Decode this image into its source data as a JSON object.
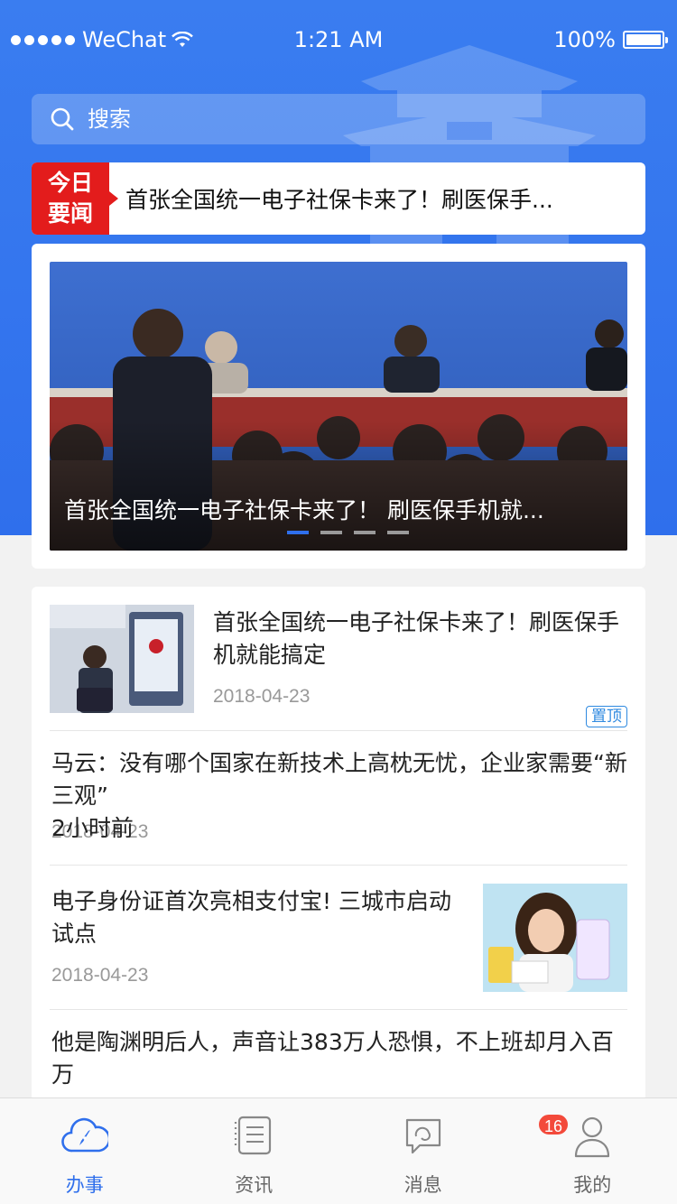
{
  "status_bar": {
    "carrier": "WeChat",
    "time": "1:21 AM",
    "battery": "100%"
  },
  "search": {
    "placeholder": "搜索"
  },
  "today_news": {
    "badge_line1": "今日",
    "badge_line2": "要闻",
    "headline": "首张全国统一电子社保卡来了！刷医保手..."
  },
  "carousel": {
    "caption": "首张全国统一电子社保卡来了！ 刷医保手机就...",
    "active_index": 0,
    "slide_count": 4
  },
  "news": [
    {
      "title": "首张全国统一电子社保卡来了！刷医保手机就能搞定",
      "date": "2018-04-23",
      "tag": "置顶"
    },
    {
      "title": "马云：没有哪个国家在新技术上高枕无忧，企业家需要“新三观”",
      "date": "2018-04-23",
      "time_ago": "2小时前"
    },
    {
      "title": "电子身份证首次亮相支付宝! 三城市启动试点",
      "date": "2018-04-23"
    },
    {
      "title": "他是陶渊明后人，声音让383万人恐惧，不上班却月入百万"
    }
  ],
  "tabs": [
    {
      "label": "办事",
      "icon": "compass-icon",
      "active": true
    },
    {
      "label": "资讯",
      "icon": "news-icon"
    },
    {
      "label": "消息",
      "icon": "message-icon",
      "badge": "16"
    },
    {
      "label": "我的",
      "icon": "user-icon"
    }
  ],
  "colors": {
    "primary": "#2f6fec",
    "hot": "#e31c1c",
    "badge": "#f34a3b"
  }
}
